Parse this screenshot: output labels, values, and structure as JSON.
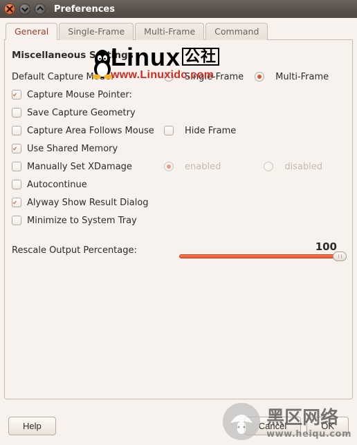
{
  "window": {
    "title": "Preferences"
  },
  "tabs": {
    "t0": "General",
    "t1": "Single-Frame",
    "t2": "Multi-Frame",
    "t3": "Command"
  },
  "section_title": "Miscellaneous Settings",
  "default_mode": {
    "label": "Default Capture Mode:",
    "single": "Single-Frame",
    "multi": "Multi-Frame",
    "selected": "multi"
  },
  "opts": {
    "capture_pointer": "Capture Mouse Pointer:",
    "save_geometry": "Save Capture Geometry",
    "area_follows": "Capture Area Follows Mouse",
    "hide_frame": "Hide Frame",
    "shared_memory": "Use Shared Memory",
    "xdamage": "Manually Set XDamage",
    "xdamage_enabled": "enabled",
    "xdamage_disabled": "disabled",
    "autocontinue": "Autocontinue",
    "show_result": "Alyway Show Result Dialog",
    "minimize_tray": "Minimize to System Tray"
  },
  "slider": {
    "label": "Rescale Output Percentage:",
    "value": "100",
    "pct": 100
  },
  "buttons": {
    "help": "Help",
    "cancel": "Cancel",
    "ok": "OK"
  },
  "watermark_top": {
    "line1_main": "Linux",
    "line1_suffix": "公社",
    "line2": "www.Linuxidc.com"
  },
  "watermark_bottom": {
    "line1": "黑区网络",
    "line2": "www.heiqu.com"
  }
}
